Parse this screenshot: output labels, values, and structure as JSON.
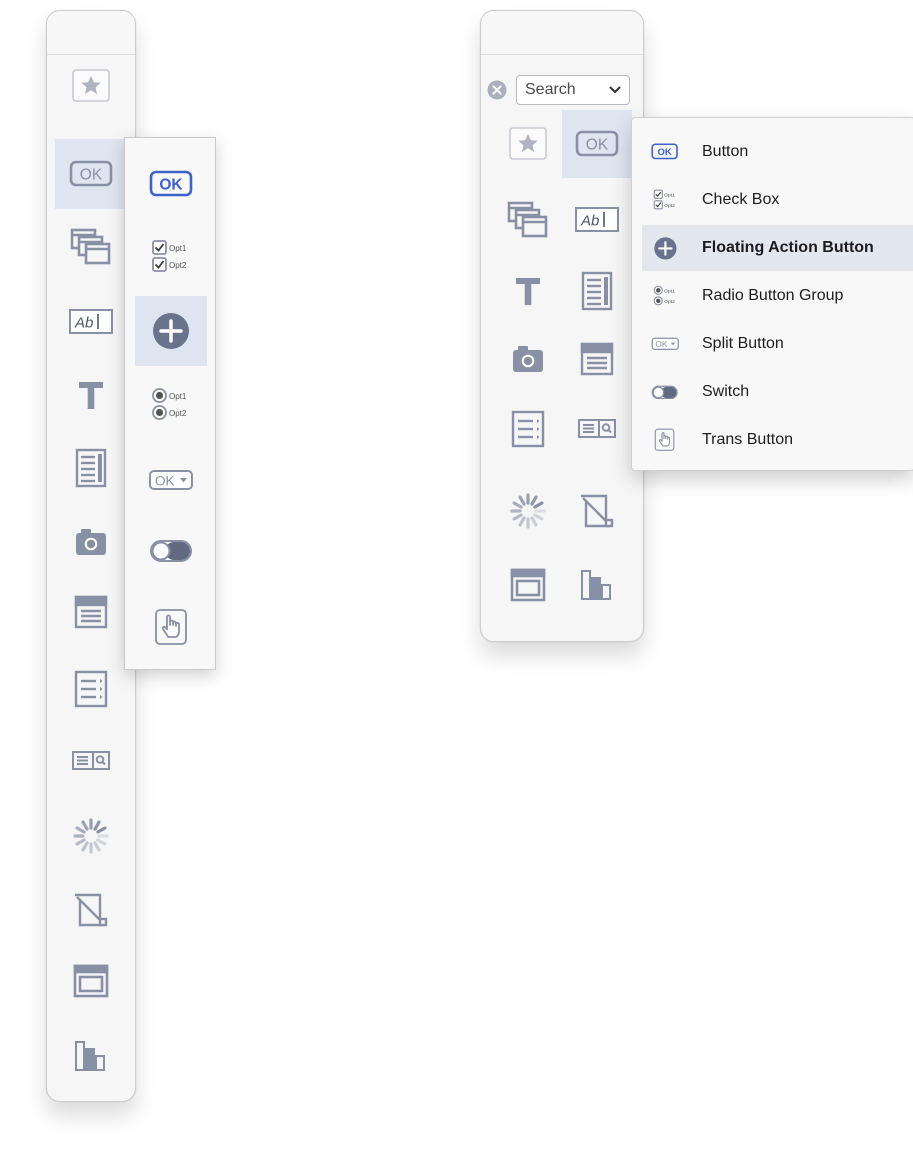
{
  "colors": {
    "icon": "#8890a5",
    "accent": "#3b63c9",
    "selection": "#dfe5f0",
    "menu_active": "#e3e7ee"
  },
  "left_palette": {
    "items": [
      "star-icon",
      "ok-button-icon",
      "overlapping-windows-icon",
      "text-field-icon",
      "text-label-icon",
      "text-view-icon",
      "camera-icon",
      "form-icon",
      "list-icon",
      "search-field-icon",
      "spinner-icon",
      "image-placeholder-icon",
      "window-icon",
      "bar-chart-icon"
    ],
    "selected": "ok-button-icon"
  },
  "left_flyout": {
    "items": [
      "ok-button-icon",
      "checkbox-icon",
      "floating-action-button-icon",
      "radio-group-icon",
      "split-button-icon",
      "switch-icon",
      "trans-button-icon"
    ],
    "selected": "floating-action-button-icon",
    "ok_text": "OK",
    "opt1": "Opt1",
    "opt2": "Opt2"
  },
  "right_panel": {
    "search": {
      "value": "Search"
    },
    "grid": [
      "star-icon",
      "ok-button-icon",
      "overlapping-windows-icon",
      "text-field-icon",
      "text-label-icon",
      "text-view-icon",
      "camera-icon",
      "form-icon",
      "list-icon",
      "search-field-icon",
      "spinner-icon",
      "image-placeholder-icon",
      "window-icon",
      "bar-chart-icon"
    ],
    "selected": "ok-button-icon"
  },
  "menu": {
    "items": [
      {
        "icon": "ok-button-icon",
        "label": "Button"
      },
      {
        "icon": "checkbox-icon",
        "label": "Check Box"
      },
      {
        "icon": "floating-action-button-icon",
        "label": "Floating Action Button"
      },
      {
        "icon": "radio-group-icon",
        "label": "Radio Button Group"
      },
      {
        "icon": "split-button-icon",
        "label": "Split Button"
      },
      {
        "icon": "switch-icon",
        "label": "Switch"
      },
      {
        "icon": "trans-button-icon",
        "label": "Trans Button"
      }
    ],
    "active_index": 2
  }
}
